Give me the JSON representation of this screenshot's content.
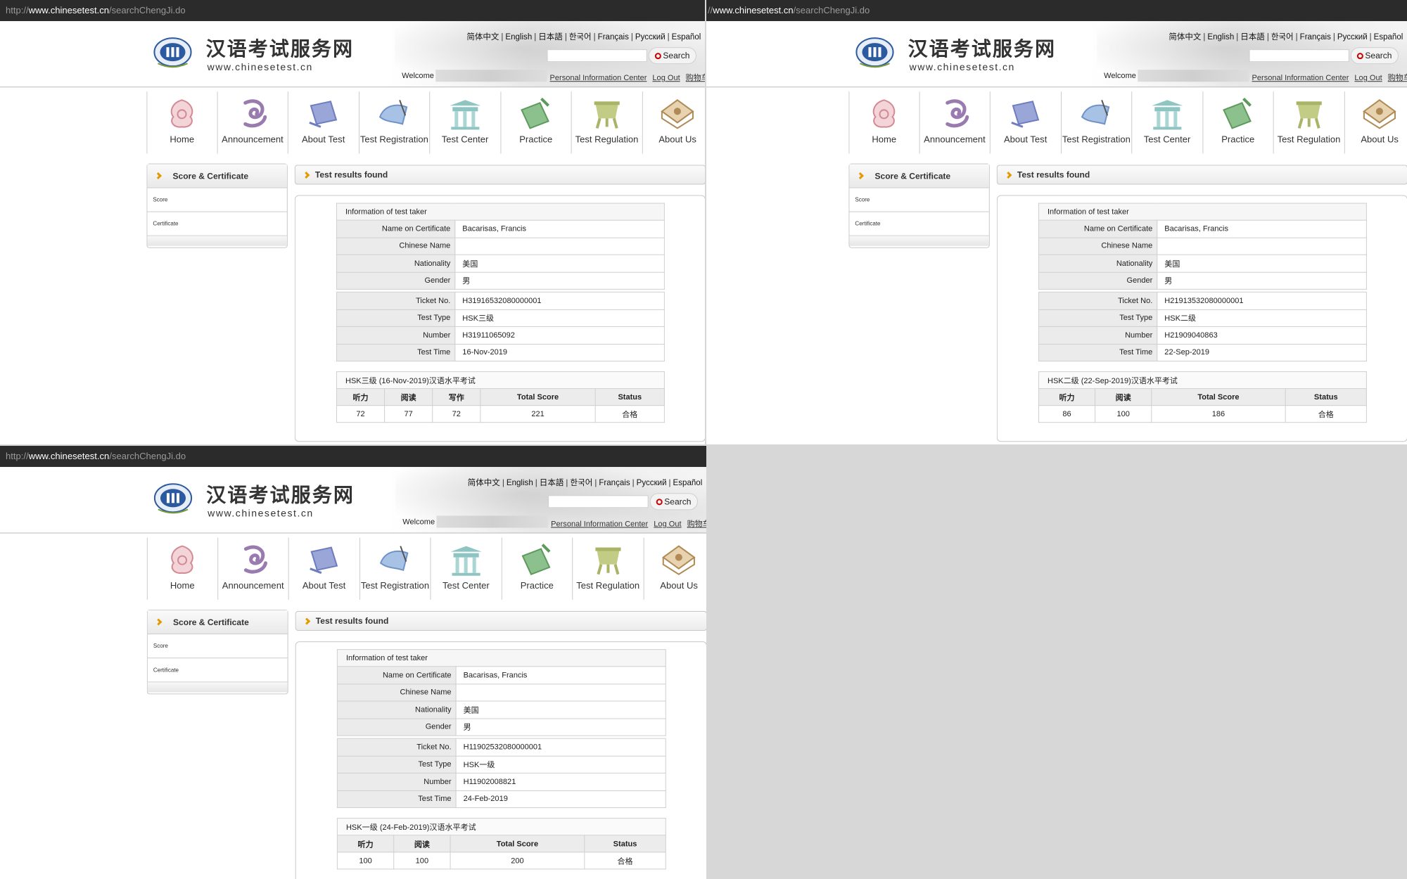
{
  "url": {
    "prefix": "http://",
    "domain": "www.chinesetest.cn",
    "path": "/searchChengJi.do",
    "alt_prefix": "//"
  },
  "header": {
    "site_title": "汉语考试服务网",
    "site_url": "www.chinesetest.cn",
    "languages": [
      "简体中文",
      "English",
      "日本語",
      "한국어",
      "Français",
      "Русский",
      "Español"
    ],
    "search_label": "Search",
    "welcome": "Welcome",
    "links": [
      "Personal Information Center",
      "Log Out",
      "购物车"
    ]
  },
  "nav": [
    "Home",
    "Announcement",
    "About Test",
    "Test Registration",
    "Test Center",
    "Practice",
    "Test Regulation",
    "About Us"
  ],
  "sidebar": {
    "title": "Score & Certificate",
    "items": [
      "Score",
      "Certificate"
    ]
  },
  "results_title": "Test results found",
  "info_caption": "Information of test taker",
  "labels": {
    "name": "Name on Certificate",
    "chinese_name": "Chinese Name",
    "nationality": "Nationality",
    "gender": "Gender",
    "ticket": "Ticket No.",
    "test_type": "Test Type",
    "number": "Number",
    "test_time": "Test Time",
    "total": "Total Score",
    "status": "Status",
    "listening": "听力",
    "reading": "阅读",
    "writing": "写作"
  },
  "panels": [
    {
      "name": "Bacarisas, Francis",
      "chinese_name": "",
      "nationality": "美国",
      "gender": "男",
      "ticket": "H31916532080000001",
      "test_type": "HSK三级",
      "number": "H31911065092",
      "test_time": "16-Nov-2019",
      "score_caption": "HSK三级 (16-Nov-2019)汉语水平考试",
      "scores": [
        "72",
        "77",
        "72"
      ],
      "total": "221",
      "status": "合格"
    },
    {
      "name": "Bacarisas, Francis",
      "chinese_name": "",
      "nationality": "美国",
      "gender": "男",
      "ticket": "H21913532080000001",
      "test_type": "HSK二级",
      "number": "H21909040863",
      "test_time": "22-Sep-2019",
      "score_caption": "HSK二级 (22-Sep-2019)汉语水平考试",
      "scores": [
        "86",
        "100"
      ],
      "total": "186",
      "status": "合格"
    },
    {
      "name": "Bacarisas, Francis",
      "chinese_name": "",
      "nationality": "美国",
      "gender": "男",
      "ticket": "H11902532080000001",
      "test_type": "HSK一级",
      "number": "H11902008821",
      "test_time": "24-Feb-2019",
      "score_caption": "HSK一级 (24-Feb-2019)汉语水平考试",
      "scores": [
        "100",
        "100"
      ],
      "total": "200",
      "status": "合格"
    }
  ],
  "colors": {
    "accent": "#e39a00",
    "urlbar": "#2b2b2b",
    "backdrop": "#d7d7d7",
    "search_icon": "#cc0000"
  }
}
